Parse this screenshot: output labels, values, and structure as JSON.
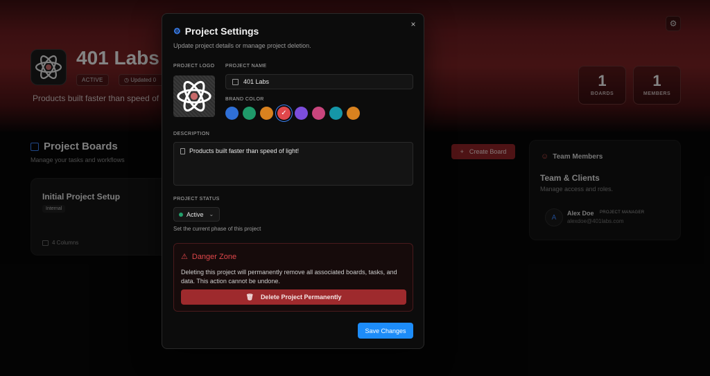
{
  "background": {
    "project_name": "401 Labs",
    "status_badge": "ACTIVE",
    "updated_text": "Updated 0",
    "tagline": "Products built faster than speed of",
    "stats": [
      {
        "value": "1",
        "label": "BOARDS"
      },
      {
        "value": "1",
        "label": "MEMBERS"
      }
    ],
    "boards_title": "Project Boards",
    "boards_subtitle": "Manage your tasks and workflows",
    "create_board_label": "Create Board",
    "create_board_icon": "+",
    "board_card": {
      "name": "Initial Project Setup",
      "tag": "Internal",
      "columns": "4 Columns"
    },
    "team": {
      "header": "Team Members",
      "title": "Team & Clients",
      "subtitle": "Manage access and roles.",
      "member": {
        "initial": "A",
        "name": "Alex Doe",
        "role": "PROJECT MANAGER",
        "email": "alexdoe@401labs.com"
      }
    }
  },
  "modal": {
    "title": "Project Settings",
    "subtitle": "Update project details or manage project deletion.",
    "close_icon": "×",
    "logo_label": "PROJECT LOGO",
    "name_label": "PROJECT NAME",
    "name_value": "401 Labs",
    "brand_color_label": "BRAND COLOR",
    "brand_colors": [
      "#2f6fd6",
      "#1f9a6a",
      "#d9821f",
      "#e0474b",
      "#7c4ddb",
      "#c8457d",
      "#1596a8",
      "#d9821f"
    ],
    "selected_color": "#e0474b",
    "check_icon": "✓",
    "description_label": "DESCRIPTION",
    "description_value": "Products built faster than speed of light!",
    "status_label": "PROJECT STATUS",
    "status_value": "Active",
    "status_help": "Set the current phase of this project",
    "danger": {
      "title": "Danger Zone",
      "text": "Deleting this project will permanently remove all associated boards, tasks, and data. This action cannot be undone.",
      "delete_label": "Delete Project Permanently"
    },
    "save_label": "Save Changes"
  },
  "colors": {
    "accent_blue": "#1d8cf8",
    "danger_red": "#9e2a2d",
    "active_green": "#22a06b"
  }
}
